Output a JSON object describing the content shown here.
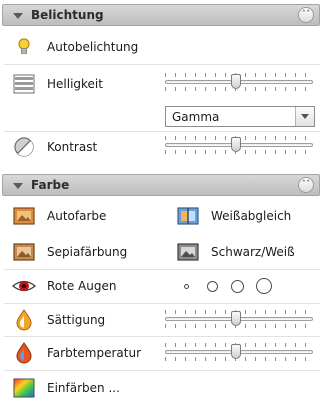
{
  "belichtung": {
    "title": "Belichtung",
    "autobelichtung": "Autobelichtung",
    "helligkeit": {
      "label": "Helligkeit",
      "level": 0.48
    },
    "gamma": {
      "selected": "Gamma"
    },
    "kontrast": {
      "label": "Kontrast",
      "level": 0.48
    }
  },
  "farbe": {
    "title": "Farbe",
    "autofarbe": "Autofarbe",
    "weissabgleich": "Weißabgleich",
    "sepiafaerbung": "Sepiafärbung",
    "schwarzweiss": "Schwarz/Weiß",
    "rote_augen": "Rote Augen",
    "saettigung": {
      "label": "Sättigung",
      "level": 0.48
    },
    "farbtemperatur": {
      "label": "Farbtemperatur",
      "level": 0.48
    },
    "einfaerben": "Einfärben ..."
  },
  "icons": {
    "collapse": "collapse-chevron-up-icon",
    "lightbulb": "lightbulb-icon",
    "brightness": "brightness-icon",
    "contrast": "contrast-icon",
    "autocolor": "auto-color-icon",
    "whitebalance": "white-balance-icon",
    "sepia": "sepia-icon",
    "bw": "black-white-icon",
    "redeye": "red-eye-icon",
    "saturation": "saturation-icon",
    "colortemp": "color-temperature-icon",
    "colorize": "colorize-icon"
  }
}
